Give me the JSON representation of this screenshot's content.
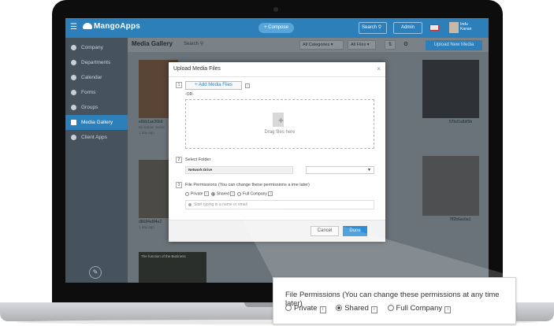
{
  "app": {
    "brand": "MangoApps",
    "compose_label": "+ Compose",
    "search_label": "Search",
    "admin_label": "Admin",
    "user_name_line1": "Indu",
    "user_name_line2": "Kanan"
  },
  "sidebar": {
    "items": [
      {
        "label": "Company"
      },
      {
        "label": "Departments"
      },
      {
        "label": "Calendar"
      },
      {
        "label": "Forms"
      },
      {
        "label": "Groups"
      },
      {
        "label": "Media Gallery"
      },
      {
        "label": "Client Apps"
      }
    ],
    "active_index": 5
  },
  "gallery": {
    "title": "Media Gallery",
    "search_placeholder": "Search",
    "category_filter": "All Categories",
    "files_filter": "All Files",
    "upload_button": "Upload New Media",
    "items": [
      {
        "caption": "e6bb1ae26b9",
        "meta": "By Kanan Jones",
        "date": "1 day ago"
      },
      {
        "caption": "d8684e8f4e2",
        "meta": "",
        "date": "1 day ago"
      },
      {
        "caption": "57bd1a8df9b",
        "meta": "",
        "date": ""
      },
      {
        "caption": "7ff2b6ac0a1",
        "meta": "",
        "date": ""
      },
      {
        "caption": "The function of the Business",
        "meta": "",
        "date": ""
      }
    ]
  },
  "modal": {
    "title": "Upload Media Files",
    "step1": "1",
    "add_media": "+ Add Media Files",
    "or_text": "-OR-",
    "drop_text": "Drag files here",
    "step2": "2",
    "select_folder_label": "Select Folder",
    "folder_value": "Network Drive",
    "step3": "3",
    "permissions_label": "File Permissions (You can change these permissions a    ime later)",
    "radio_private": "Private",
    "radio_shared": "Shared",
    "radio_full": "Full Company",
    "people_placeholder": "Start typing in a name or email",
    "cancel_label": "Cancel",
    "done_label": "Done"
  },
  "callout": {
    "title": "File Permissions (You can change these permissions at any time later)",
    "option_private": "Private",
    "option_shared": "Shared",
    "option_full": "Full Company",
    "info_glyph": "i",
    "selected": "Shared"
  },
  "colors": {
    "brand_blue": "#2c7fb8",
    "button_blue": "#2c8ed6"
  }
}
